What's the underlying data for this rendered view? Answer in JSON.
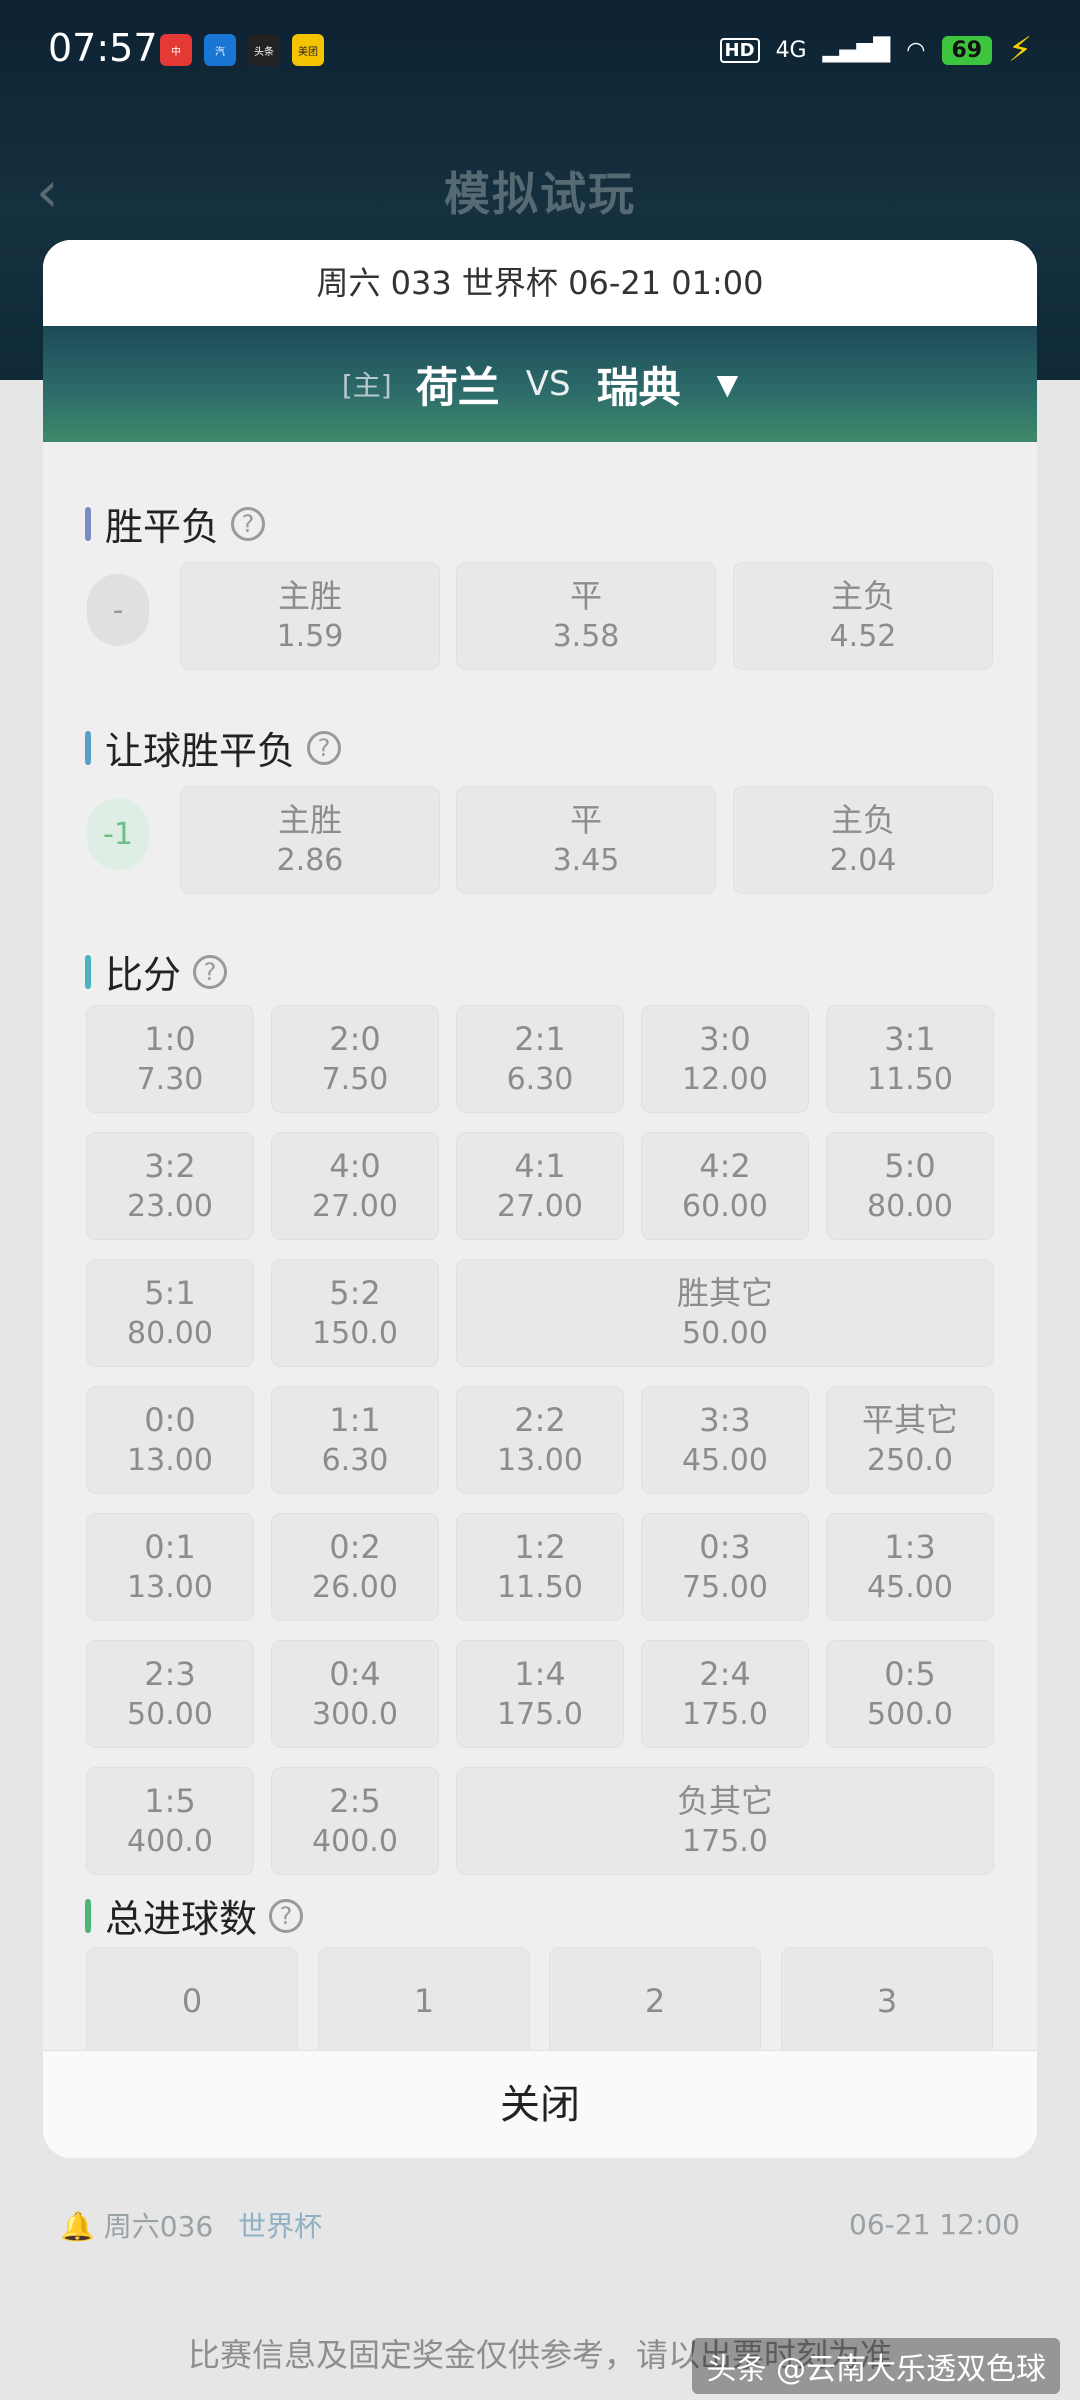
{
  "status_bar": {
    "time": "07:57",
    "apps": [
      {
        "label": "中",
        "color": "#e53935",
        "icon": "red-app-icon"
      },
      {
        "label": "汽",
        "color": "#1976d2",
        "icon": "blue-app-icon"
      },
      {
        "label": "头条",
        "color": "#222222",
        "icon": "toutiao-icon"
      },
      {
        "label": "美团",
        "color": "#f5c400",
        "icon": "meituan-icon"
      }
    ],
    "hd": "HD",
    "network": "4G",
    "battery": "69"
  },
  "background": {
    "title": "模拟试玩",
    "footer_match": "周六036",
    "footer_league": "世界杯",
    "footer_date": "06-21 12:00",
    "notice": "比赛信息及固定奖金仅供参考，请以出票时刻为准",
    "watermark": "头条 @云南大乐透双色球"
  },
  "modal": {
    "match_info": "周六 033 世界杯 06-21 01:00",
    "home_tag": "[主]",
    "home_team": "荷兰",
    "vs": "VS",
    "away_team": "瑞典",
    "close_label": "关闭"
  },
  "sections": {
    "spf": {
      "title": "胜平负",
      "bar_color": "#7b8cc0",
      "chip": "-",
      "options": [
        {
          "label": "主胜",
          "odds": "1.59"
        },
        {
          "label": "平",
          "odds": "3.58"
        },
        {
          "label": "主负",
          "odds": "4.52"
        }
      ]
    },
    "rqspf": {
      "title": "让球胜平负",
      "bar_color": "#5aa0c8",
      "chip": "-1",
      "options": [
        {
          "label": "主胜",
          "odds": "2.86"
        },
        {
          "label": "平",
          "odds": "3.45"
        },
        {
          "label": "主负",
          "odds": "2.04"
        }
      ]
    },
    "score": {
      "title": "比分",
      "bar_color": "#4bb0c0",
      "rows": [
        [
          {
            "label": "1:0",
            "odds": "7.30"
          },
          {
            "label": "2:0",
            "odds": "7.50"
          },
          {
            "label": "2:1",
            "odds": "6.30"
          },
          {
            "label": "3:0",
            "odds": "12.00"
          },
          {
            "label": "3:1",
            "odds": "11.50"
          }
        ],
        [
          {
            "label": "3:2",
            "odds": "23.00"
          },
          {
            "label": "4:0",
            "odds": "27.00"
          },
          {
            "label": "4:1",
            "odds": "27.00"
          },
          {
            "label": "4:2",
            "odds": "60.00"
          },
          {
            "label": "5:0",
            "odds": "80.00"
          }
        ],
        [
          {
            "label": "5:1",
            "odds": "80.00"
          },
          {
            "label": "5:2",
            "odds": "150.0"
          },
          {
            "label": "胜其它",
            "odds": "50.00"
          }
        ],
        [
          {
            "label": "0:0",
            "odds": "13.00"
          },
          {
            "label": "1:1",
            "odds": "6.30"
          },
          {
            "label": "2:2",
            "odds": "13.00"
          },
          {
            "label": "3:3",
            "odds": "45.00"
          },
          {
            "label": "平其它",
            "odds": "250.0"
          }
        ],
        [
          {
            "label": "0:1",
            "odds": "13.00"
          },
          {
            "label": "0:2",
            "odds": "26.00"
          },
          {
            "label": "1:2",
            "odds": "11.50"
          },
          {
            "label": "0:3",
            "odds": "75.00"
          },
          {
            "label": "1:3",
            "odds": "45.00"
          }
        ],
        [
          {
            "label": "2:3",
            "odds": "50.00"
          },
          {
            "label": "0:4",
            "odds": "300.0"
          },
          {
            "label": "1:4",
            "odds": "175.0"
          },
          {
            "label": "2:4",
            "odds": "175.0"
          },
          {
            "label": "0:5",
            "odds": "500.0"
          }
        ],
        [
          {
            "label": "1:5",
            "odds": "400.0"
          },
          {
            "label": "2:5",
            "odds": "400.0"
          },
          {
            "label": "负其它",
            "odds": "175.0"
          }
        ]
      ]
    },
    "goals": {
      "title": "总进球数",
      "bar_color": "#4cb878",
      "options": [
        "0",
        "1",
        "2",
        "3"
      ]
    }
  }
}
